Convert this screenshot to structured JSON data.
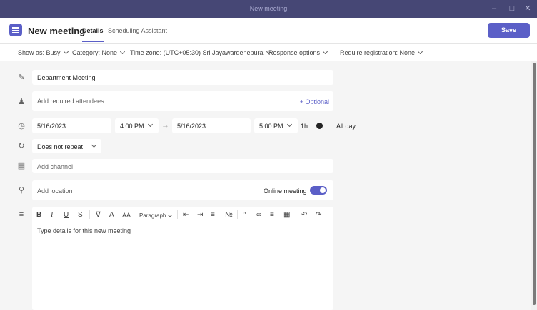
{
  "window": {
    "title": "New meeting"
  },
  "header": {
    "title": "New meeting",
    "tabs": [
      {
        "label": "Details",
        "active": true
      },
      {
        "label": "Scheduling Assistant",
        "active": false
      }
    ],
    "save_label": "Save"
  },
  "options": {
    "show_as": "Show as: Busy",
    "category": "Category: None",
    "time_zone": "Time zone: (UTC+05:30) Sri Jayawardenepura",
    "response_options": "Response options",
    "registration": "Require registration: None"
  },
  "form": {
    "title_value": "Department Meeting",
    "attendees_placeholder": "Add required attendees",
    "optional_label": "+ Optional",
    "start_date": "5/16/2023",
    "start_time": "4:00 PM",
    "end_date": "5/16/2023",
    "end_time": "5:00 PM",
    "duration": "1h",
    "all_day_label": "All day",
    "repeat": "Does not repeat",
    "channel_placeholder": "Add channel",
    "location_placeholder": "Add location",
    "online_meeting_label": "Online meeting",
    "online_meeting_on": true
  },
  "editor": {
    "paragraph_label": "Paragraph",
    "details_placeholder": "Type details for this new meeting"
  },
  "colors": {
    "titlebar": "#464775",
    "accent": "#5b5fc7"
  }
}
